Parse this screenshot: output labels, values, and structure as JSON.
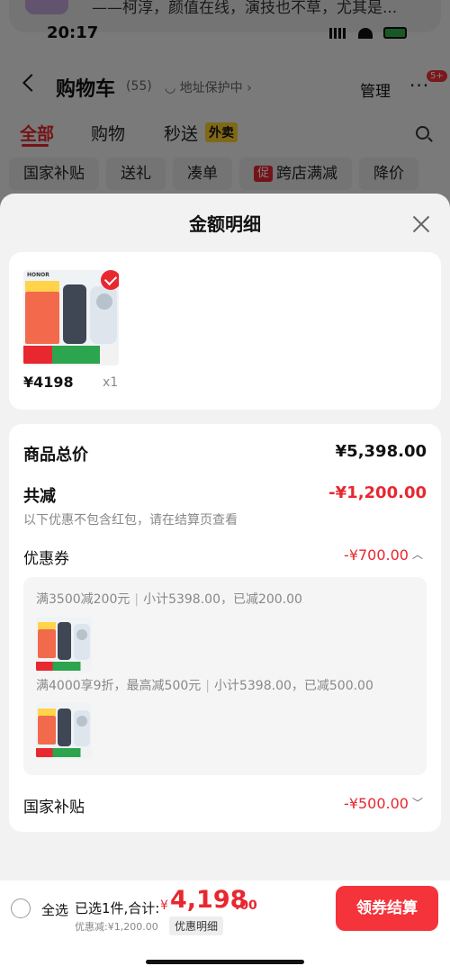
{
  "notification": {
    "text": "——柯淳，颜值在线，演技也不草，尤其是..."
  },
  "status_bar": {
    "time": "20:17"
  },
  "background_page": {
    "title": "购物车",
    "count": "(55)",
    "address": "地址保护中",
    "manage": "管理",
    "badge": "5+",
    "tabs": [
      {
        "label": "全部"
      },
      {
        "label": "购物"
      },
      {
        "label": "秒送"
      }
    ],
    "takeout_tag": "外卖",
    "chips": [
      {
        "label": "国家补贴"
      },
      {
        "label": "送礼"
      },
      {
        "label": "凑单"
      },
      {
        "label": "跨店满减"
      },
      {
        "label": "降价"
      }
    ],
    "chip_tag": "促"
  },
  "sheet": {
    "title": "金额明细",
    "product": {
      "brand": "HONOR",
      "price": "¥4198",
      "quantity": "x1"
    },
    "total_label": "商品总价",
    "total_value": "¥5,398.00",
    "reduction_label": "共减",
    "reduction_value": "-¥1,200.00",
    "reduction_note": "以下优惠不包含红包，请在结算页查看",
    "coupon_label": "优惠券",
    "coupon_value": "-¥700.00",
    "coupon_lines": [
      {
        "rule": "满3500减200元",
        "summary": "小计5398.00，已减200.00"
      },
      {
        "rule": "满4000享9折，最高减500元",
        "summary": "小计5398.00，已减500.00"
      }
    ],
    "subsidy_label": "国家补贴",
    "subsidy_value": "-¥500.00"
  },
  "checkout": {
    "select_all": "全选",
    "selected_info": "已选1件,合计:",
    "total_yen": "¥",
    "total_int": "4,198",
    "total_dec": ".00",
    "discount_info": "优惠减:¥1,200.00",
    "detail_link": "优惠明细",
    "button": "领券结算"
  },
  "colors": {
    "accent": "#e8272f",
    "button": "#f5333b"
  }
}
